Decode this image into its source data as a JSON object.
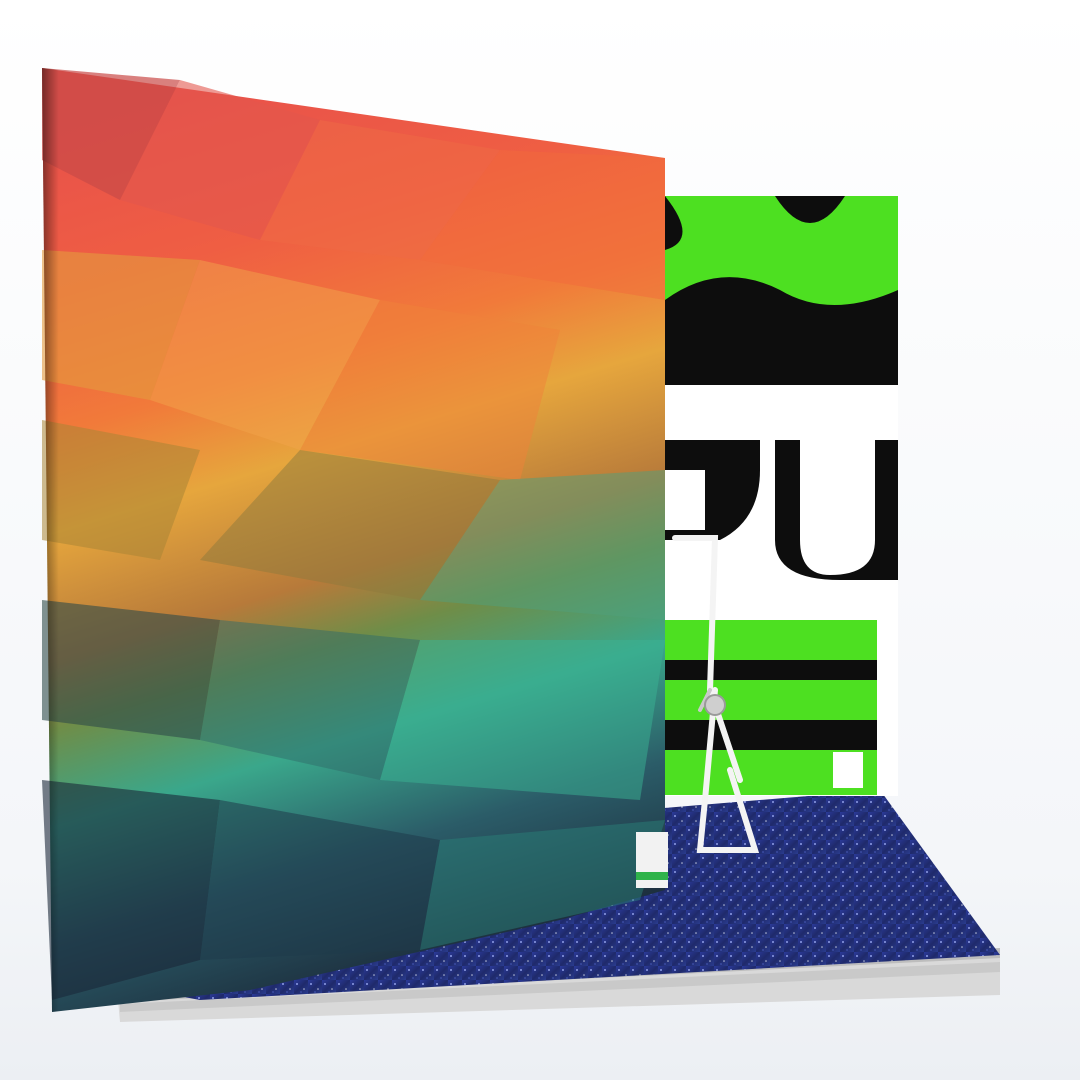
{
  "scene": {
    "description_free": true,
    "background_color": "#f7f8fa",
    "objects": [
      {
        "name": "rainbow-poly-book",
        "palette": [
          "#e8514b",
          "#f2703a",
          "#e8a53a",
          "#3cb39a",
          "#1d3a4a",
          "#1b2838"
        ]
      },
      {
        "name": "green-pattern-book",
        "palette": [
          "#4de021",
          "#0d0d0d",
          "#ffffff"
        ]
      },
      {
        "name": "glitter-book",
        "palette": [
          "#1f2a6b",
          "#2d3fa0",
          "#9fb0ff"
        ]
      },
      {
        "name": "plate-stand",
        "palette": [
          "#ffffff",
          "#b8b8b8"
        ]
      }
    ]
  }
}
